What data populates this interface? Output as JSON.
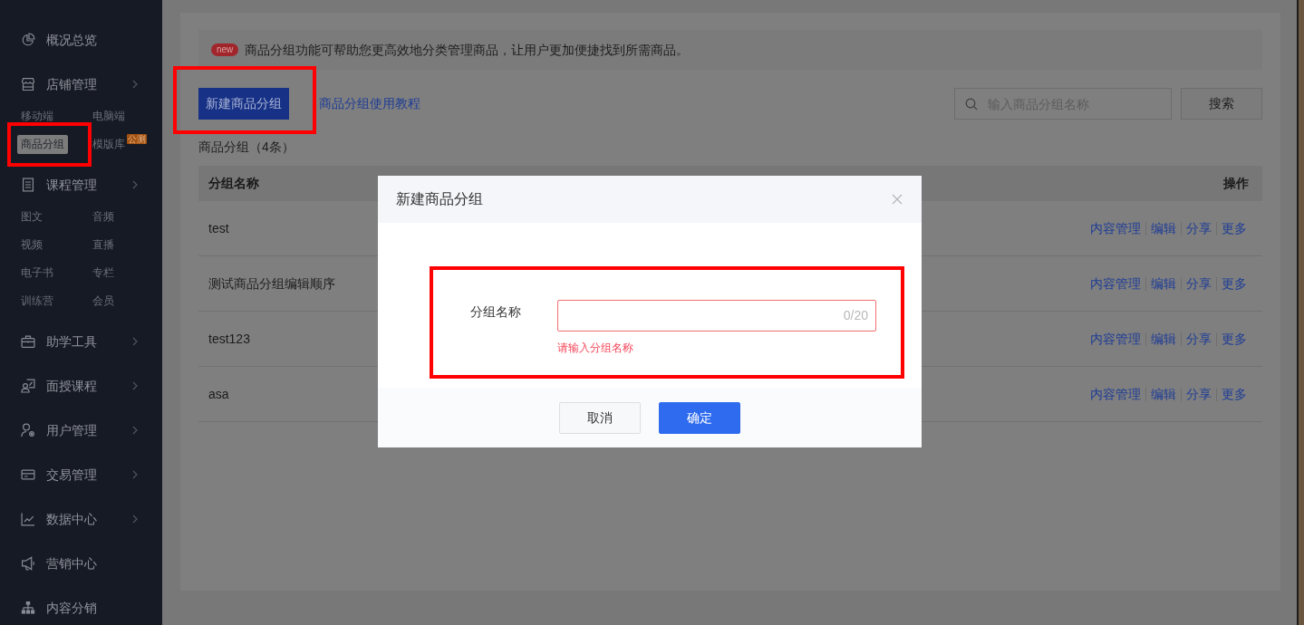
{
  "sidebar": {
    "items": [
      {
        "label": "概况总览",
        "expandable": false
      },
      {
        "label": "店铺管理",
        "expandable": true,
        "children": [
          {
            "label": "移动端",
            "selected": false,
            "marked": false
          },
          {
            "label": "电脑端",
            "selected": false,
            "marked": false
          },
          {
            "label": "商品分组",
            "selected": true,
            "marked": true
          },
          {
            "label": "模版库",
            "selected": false,
            "marked": false,
            "badge": "公测"
          }
        ]
      },
      {
        "label": "课程管理",
        "expandable": true,
        "children": [
          {
            "label": "图文",
            "selected": false,
            "marked": false
          },
          {
            "label": "音频",
            "selected": false,
            "marked": false
          },
          {
            "label": "视频",
            "selected": false,
            "marked": false
          },
          {
            "label": "直播",
            "selected": false,
            "marked": false
          },
          {
            "label": "电子书",
            "selected": false,
            "marked": false
          },
          {
            "label": "专栏",
            "selected": false,
            "marked": false
          },
          {
            "label": "训练营",
            "selected": false,
            "marked": false
          },
          {
            "label": "会员",
            "selected": false,
            "marked": false
          }
        ]
      },
      {
        "label": "助学工具",
        "expandable": true
      },
      {
        "label": "面授课程",
        "expandable": true
      },
      {
        "label": "用户管理",
        "expandable": true
      },
      {
        "label": "交易管理",
        "expandable": true
      },
      {
        "label": "数据中心",
        "expandable": true
      },
      {
        "label": "营销中心",
        "expandable": false
      },
      {
        "label": "内容分销",
        "expandable": false
      }
    ]
  },
  "notice": {
    "badge": "new",
    "text": "商品分组功能可帮助您更高效地分类管理商品，让用户更加便捷找到所需商品。"
  },
  "toolbar": {
    "create_button": {
      "label": "新建商品分组",
      "marked": true
    },
    "tutorial_link": "商品分组使用教程",
    "search": {
      "placeholder": "输入商品分组名称"
    },
    "search_button": "搜索"
  },
  "count": "商品分组（4条）",
  "table": {
    "columns": [
      "分组名称",
      "操作"
    ],
    "rows": [
      {
        "name": "test",
        "actions": [
          "内容管理",
          "编辑",
          "分享",
          "更多"
        ]
      },
      {
        "name": "测试商品分组编辑顺序",
        "actions": [
          "内容管理",
          "编辑",
          "分享",
          "更多"
        ]
      },
      {
        "name": "test123",
        "actions": [
          "内容管理",
          "编辑",
          "分享",
          "更多"
        ]
      },
      {
        "name": "asa",
        "actions": [
          "内容管理",
          "编辑",
          "分享",
          "更多"
        ]
      }
    ]
  },
  "dialog": {
    "title": "新建商品分组",
    "form": {
      "label": "分组名称",
      "counter": "0/20",
      "error": "请输入分组名称",
      "marked": true
    },
    "buttons": [
      {
        "label": "取消",
        "kind": "secondary"
      },
      {
        "label": "确定",
        "kind": "primary"
      }
    ]
  }
}
